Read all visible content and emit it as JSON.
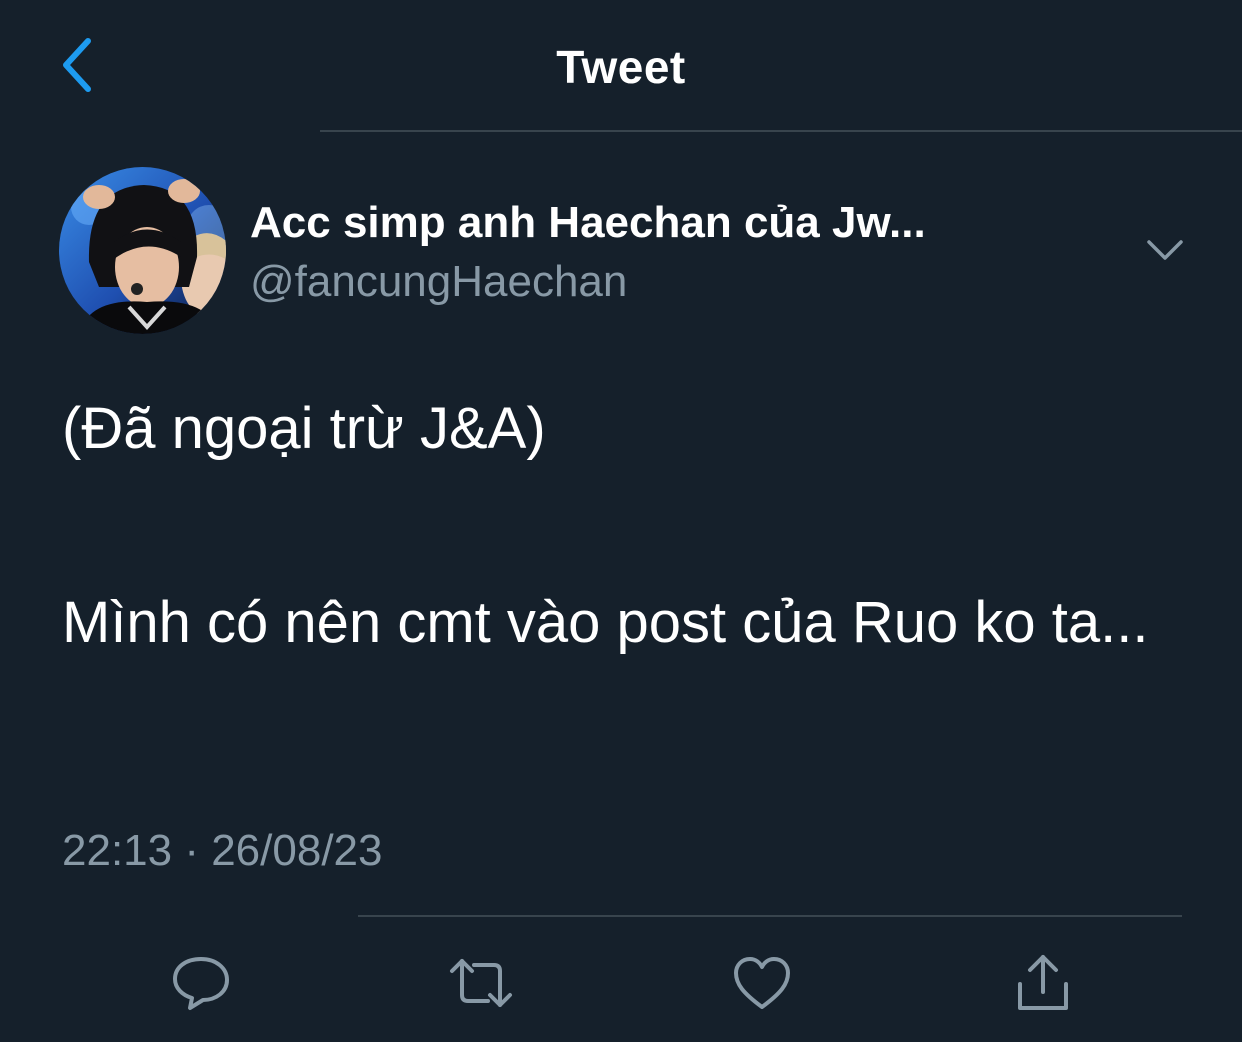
{
  "header": {
    "title": "Tweet",
    "back_icon": "chevron-left-icon",
    "accent_color": "#1d9bf0"
  },
  "tweet": {
    "author": {
      "display_name": "Acc simp anh Haechan của Jw...",
      "handle": "@fancungHaechan",
      "avatar": "profile photo"
    },
    "body_lines": [
      "(Đã ngoại trừ J&A)",
      "Mình có nên cmt vào post của Ruo ko ta..."
    ],
    "timestamp": "22:13 · 26/08/23"
  },
  "actions": [
    {
      "name": "reply",
      "icon": "reply-icon"
    },
    {
      "name": "retweet",
      "icon": "retweet-icon"
    },
    {
      "name": "like",
      "icon": "heart-icon"
    },
    {
      "name": "share",
      "icon": "share-icon"
    }
  ],
  "colors": {
    "background": "#15202b",
    "text": "#ffffff",
    "secondary_text": "#8899a6",
    "divider": "#38444d"
  }
}
